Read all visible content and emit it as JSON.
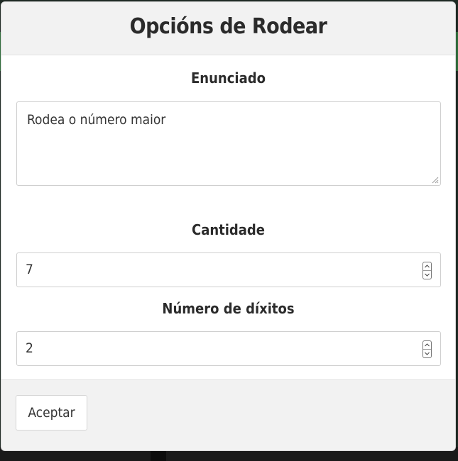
{
  "dialog": {
    "title": "Opcións de Rodear",
    "statement": {
      "label": "Enunciado",
      "value": "Rodea o número maior"
    },
    "quantity": {
      "label": "Cantidade",
      "value": "7"
    },
    "digits": {
      "label": "Número de díxitos",
      "value": "2"
    },
    "footer": {
      "accept_label": "Aceptar"
    }
  },
  "icons": {
    "resize": "resize-grip-icon",
    "spin_up": "chevron-up-icon",
    "spin_down": "chevron-down-icon"
  }
}
